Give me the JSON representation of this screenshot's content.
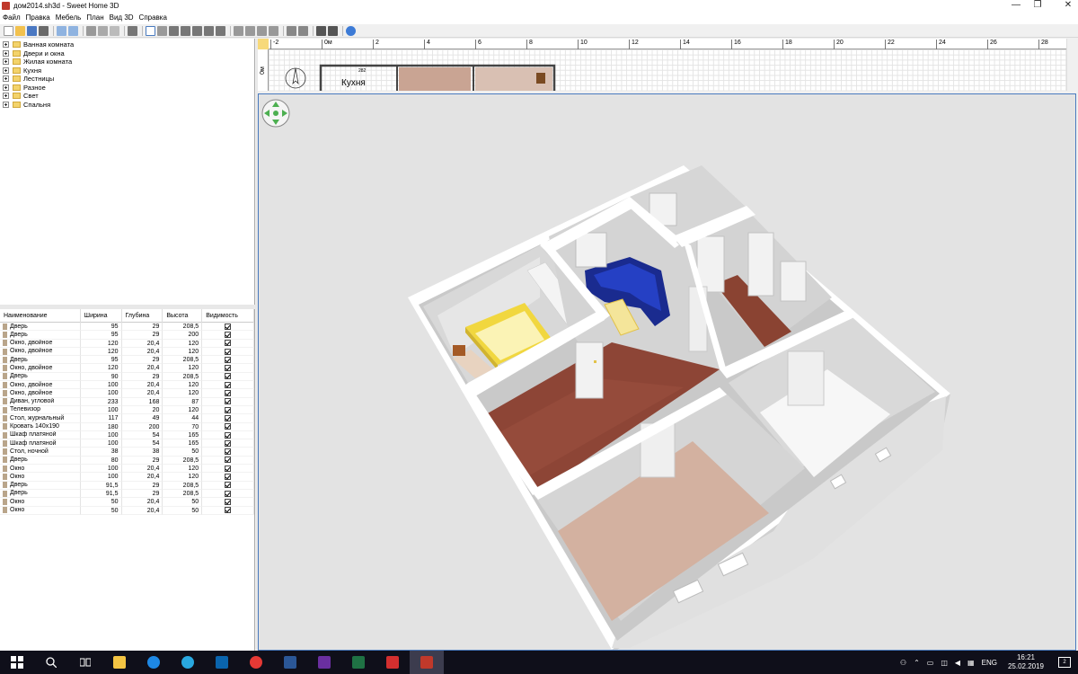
{
  "window": {
    "title": "дом2014.sh3d - Sweet Home 3D",
    "minimize_glyph": "—",
    "restore_glyph": "❐",
    "close_glyph": "✕"
  },
  "menu": [
    "Файл",
    "Правка",
    "Мебель",
    "План",
    "Вид 3D",
    "Справка"
  ],
  "catalog": {
    "categories": [
      "Ванная комната",
      "Двери и окна",
      "Жилая комната",
      "Кухня",
      "Лестницы",
      "Разное",
      "Свет",
      "Спальня"
    ]
  },
  "furniture": {
    "columns": {
      "name": "Наименование",
      "width": "Ширина",
      "depth": "Глубина",
      "height": "Высота",
      "visible": "Видимость"
    },
    "rows": [
      {
        "name": "Дверь",
        "w": "95",
        "d": "29",
        "h": "208,5"
      },
      {
        "name": "Дверь",
        "w": "95",
        "d": "29",
        "h": "200"
      },
      {
        "name": "Окно, двойное",
        "w": "120",
        "d": "20,4",
        "h": "120"
      },
      {
        "name": "Окно, двойное",
        "w": "120",
        "d": "20,4",
        "h": "120"
      },
      {
        "name": "Дверь",
        "w": "95",
        "d": "29",
        "h": "208,5"
      },
      {
        "name": "Окно, двойное",
        "w": "120",
        "d": "20,4",
        "h": "120"
      },
      {
        "name": "Дверь",
        "w": "90",
        "d": "29",
        "h": "208,5"
      },
      {
        "name": "Окно, двойное",
        "w": "100",
        "d": "20,4",
        "h": "120"
      },
      {
        "name": "Окно, двойное",
        "w": "100",
        "d": "20,4",
        "h": "120"
      },
      {
        "name": "Диван, угловой",
        "w": "233",
        "d": "168",
        "h": "87"
      },
      {
        "name": "Телевизор",
        "w": "100",
        "d": "20",
        "h": "120"
      },
      {
        "name": "Стол, журнальный",
        "w": "117",
        "d": "49",
        "h": "44"
      },
      {
        "name": "Кровать 140x190",
        "w": "180",
        "d": "200",
        "h": "70"
      },
      {
        "name": "Шкаф платяной",
        "w": "100",
        "d": "54",
        "h": "165"
      },
      {
        "name": "Шкаф платяной",
        "w": "100",
        "d": "54",
        "h": "165"
      },
      {
        "name": "Стол, ночной",
        "w": "38",
        "d": "38",
        "h": "50"
      },
      {
        "name": "Дверь",
        "w": "80",
        "d": "29",
        "h": "208,5"
      },
      {
        "name": "Окно",
        "w": "100",
        "d": "20,4",
        "h": "120"
      },
      {
        "name": "Окно",
        "w": "100",
        "d": "20,4",
        "h": "120"
      },
      {
        "name": "Дверь",
        "w": "91,5",
        "d": "29",
        "h": "208,5"
      },
      {
        "name": "Дверь",
        "w": "91,5",
        "d": "29",
        "h": "208,5"
      },
      {
        "name": "Окно",
        "w": "50",
        "d": "20,4",
        "h": "50"
      },
      {
        "name": "Окно",
        "w": "50",
        "d": "20,4",
        "h": "50"
      }
    ]
  },
  "plan": {
    "ruler_top": [
      "-2",
      "0м",
      "2",
      "4",
      "6",
      "8",
      "10",
      "12",
      "14",
      "16",
      "18",
      "20",
      "22",
      "24",
      "26",
      "28"
    ],
    "ruler_left": "0м",
    "room_label": "Кухня",
    "dimension": "282"
  },
  "taskbar": {
    "language": "ENG",
    "time": "16:21",
    "date": "25.02.2019",
    "notifications": "2"
  },
  "colors": {
    "view_bg": "#e3e3e3",
    "floor_brick": "#8d4536",
    "floor_tile": "#d3b1a0",
    "sofa": "#1a2b8f",
    "bed": "#f0d540",
    "wall_top": "#ffffff",
    "wall_side": "#d8d8d8",
    "room_floor_white": "#f7f7f7"
  }
}
